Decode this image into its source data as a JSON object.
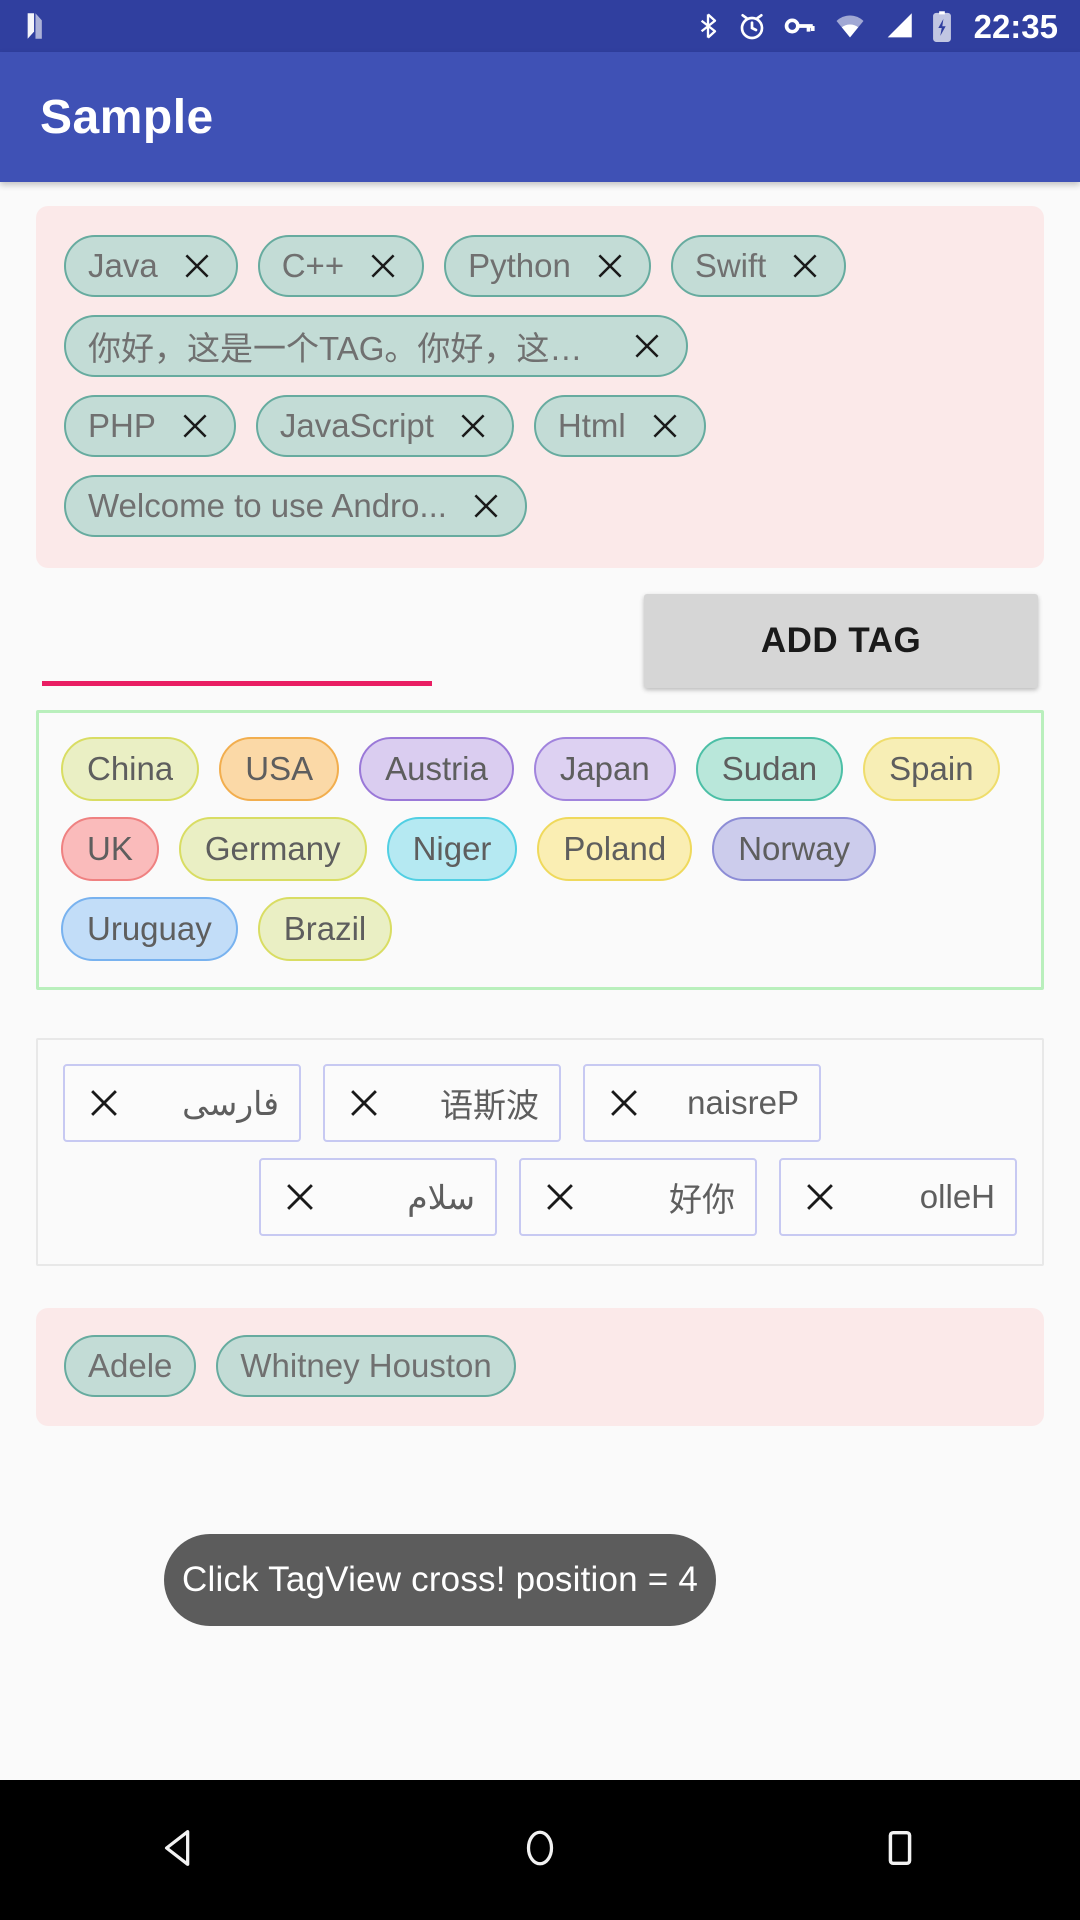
{
  "status_bar": {
    "time": "22:35",
    "icons": [
      "n-logo-icon",
      "bluetooth-icon",
      "alarm-icon",
      "vpn-key-icon",
      "wifi-icon",
      "signal-icon",
      "battery-charging-icon"
    ]
  },
  "app_bar": {
    "title": "Sample"
  },
  "tag_group_language": {
    "rows": [
      [
        {
          "label": "Java",
          "close": "close-icon"
        },
        {
          "label": "C++",
          "close": "close-icon"
        },
        {
          "label": "Python",
          "close": "close-icon"
        },
        {
          "label": "Swift",
          "close": "close-icon"
        }
      ],
      [
        {
          "label": "你好，这是一个TAG。你好，这是一个TA...",
          "close": "close-icon"
        }
      ],
      [
        {
          "label": "PHP",
          "close": "close-icon"
        },
        {
          "label": "JavaScript",
          "close": "close-icon"
        },
        {
          "label": "Html",
          "close": "close-icon"
        }
      ],
      [
        {
          "label": "Welcome to use Andro...",
          "close": "close-icon"
        }
      ]
    ]
  },
  "add_tag_row": {
    "input_value": "",
    "input_placeholder": "",
    "button_label": "ADD TAG",
    "underline_color": "#e91e63"
  },
  "tag_group_countries": {
    "rows": [
      [
        {
          "label": "China",
          "bg": "#eaefc4",
          "border": "#d9dd63"
        },
        {
          "label": "USA",
          "bg": "#fbd9a7",
          "border": "#f2ae4e"
        },
        {
          "label": "Austria",
          "bg": "#dacdf0",
          "border": "#9a78d8"
        },
        {
          "label": "Japan",
          "bg": "#ddd1f2",
          "border": "#a184dd"
        },
        {
          "label": "Sudan",
          "bg": "#b9e7da",
          "border": "#4cbfa6"
        },
        {
          "label": "Spain",
          "bg": "#f7eeb5",
          "border": "#efdd6c"
        }
      ],
      [
        {
          "label": "UK",
          "bg": "#fabbbb",
          "border": "#ef8181"
        },
        {
          "label": "Germany",
          "bg": "#eaefc4",
          "border": "#d9dd63"
        },
        {
          "label": "Niger",
          "bg": "#b5e9f2",
          "border": "#51cfe3"
        },
        {
          "label": "Poland",
          "bg": "#faeeb3",
          "border": "#efd95c"
        },
        {
          "label": "Norway",
          "bg": "#ccccec",
          "border": "#8d8dd6"
        }
      ],
      [
        {
          "label": "Uruguay",
          "bg": "#c2ddf8",
          "border": "#78b2ef"
        },
        {
          "label": "Brazil",
          "bg": "#eaefc4",
          "border": "#d9dd63"
        }
      ]
    ]
  },
  "tag_group_rtl": {
    "rows": [
      [
        {
          "label": "فارسی",
          "close": "close-icon"
        },
        {
          "label": "语斯波",
          "close": "close-icon"
        },
        {
          "label": "naisreP",
          "close": "close-icon"
        }
      ],
      [
        {
          "label": "سلام",
          "close": "close-icon"
        },
        {
          "label": "好你",
          "close": "close-icon"
        },
        {
          "label": "olleH",
          "close": "close-icon"
        }
      ]
    ]
  },
  "tag_group_singers": {
    "rows": [
      [
        {
          "label": "Adele"
        },
        {
          "label": "Whitney Houston"
        }
      ]
    ]
  },
  "toast": {
    "message": "Click TagView cross! position = 4"
  },
  "nav_bar": {
    "back": "back-triangle-icon",
    "home": "home-circle-icon",
    "recents": "recents-square-icon"
  },
  "colors": {
    "status_bar": "#303f9f",
    "app_bar": "#3f51b5",
    "accent": "#e91e63",
    "chip_bg": "#c3dcd6",
    "chip_border": "#67ab9f",
    "pink_panel": "#fbe9e9",
    "green_border": "#b9efbc",
    "rtl_border": "#c7c9f2"
  }
}
